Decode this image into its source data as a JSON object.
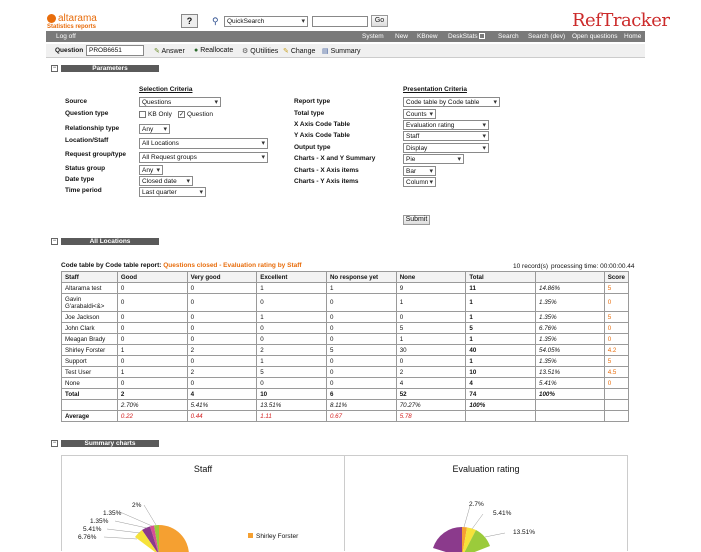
{
  "header": {
    "brand_name": "altarama",
    "brand_sub": "Statistics reports",
    "quicksearch_value": "QuickSearch",
    "go_label": "Go",
    "product_logo": "RefTracker"
  },
  "nav": {
    "logoff": "Log off",
    "items": [
      "System",
      "New",
      "KBnew",
      "DeskStats",
      "Search",
      "Search (dev)",
      "Open questions",
      "Home"
    ]
  },
  "question_bar": {
    "label": "Question",
    "value": "PROB6651",
    "actions": [
      "Answer",
      "Reallocate",
      "QUtilities",
      "Change",
      "Summary"
    ]
  },
  "parameters": {
    "title": "Parameters",
    "selection_header": "Selection Criteria",
    "presentation_header": "Presentation Criteria",
    "source_label": "Source",
    "source_value": "Questions",
    "question_type_label": "Question type",
    "kb_only_label": "KB Only",
    "question_label": "Question",
    "relationship_label": "Relationship type",
    "relationship_value": "Any",
    "location_label": "Location/Staff",
    "location_value": "All Locations",
    "request_group_label": "Request group/type",
    "request_group_value": "All Request groups",
    "status_label": "Status group",
    "status_value": "Any",
    "date_type_label": "Date type",
    "date_type_value": "Closed date",
    "time_period_label": "Time period",
    "time_period_value": "Last quarter",
    "report_type_label": "Report type",
    "report_type_value": "Code table by Code table",
    "total_type_label": "Total type",
    "total_type_value": "Counts",
    "x_axis_label": "X Axis Code Table",
    "x_axis_value": "Evaluation rating",
    "y_axis_label": "Y Axis Code Table",
    "y_axis_value": "Staff",
    "output_type_label": "Output type",
    "output_type_value": "Display",
    "charts_xy_label": "Charts - X and Y Summary",
    "charts_xy_value": "Pie",
    "charts_x_label": "Charts - X Axis items",
    "charts_x_value": "Bar",
    "charts_y_label": "Charts - Y Axis items",
    "charts_y_value": "Column",
    "submit_label": "Submit"
  },
  "results": {
    "section_title": "All Locations",
    "report_prefix": "Code table by Code table report:",
    "report_title": "Questions closed - Evaluation rating by Staff",
    "record_count": "10 record(s)",
    "processing_time": "processing time: 00:00:00.44",
    "columns": [
      "Staff",
      "Good",
      "Very good",
      "Excellent",
      "No response yet",
      "None",
      "Total",
      "",
      "Score"
    ],
    "rows": [
      {
        "name": "Altarama test",
        "good": "0",
        "very_good": "0",
        "excellent": "1",
        "no_response": "1",
        "none": "9",
        "total": "11",
        "pct": "14.86%",
        "score": "5"
      },
      {
        "name": "Gavin G'arabaldi<&>",
        "good": "0",
        "very_good": "0",
        "excellent": "0",
        "no_response": "0",
        "none": "1",
        "total": "1",
        "pct": "1.35%",
        "score": "0"
      },
      {
        "name": "Joe Jackson",
        "good": "0",
        "very_good": "0",
        "excellent": "1",
        "no_response": "0",
        "none": "0",
        "total": "1",
        "pct": "1.35%",
        "score": "5"
      },
      {
        "name": "John Clark",
        "good": "0",
        "very_good": "0",
        "excellent": "0",
        "no_response": "0",
        "none": "5",
        "total": "5",
        "pct": "6.76%",
        "score": "0"
      },
      {
        "name": "Meagan Brady",
        "good": "0",
        "very_good": "0",
        "excellent": "0",
        "no_response": "0",
        "none": "1",
        "total": "1",
        "pct": "1.35%",
        "score": "0"
      },
      {
        "name": "Shirley Forster",
        "good": "1",
        "very_good": "2",
        "excellent": "2",
        "no_response": "5",
        "none": "30",
        "total": "40",
        "pct": "54.05%",
        "score": "4.2"
      },
      {
        "name": "Support",
        "good": "0",
        "very_good": "0",
        "excellent": "1",
        "no_response": "0",
        "none": "0",
        "total": "1",
        "pct": "1.35%",
        "score": "5"
      },
      {
        "name": "Test User",
        "good": "1",
        "very_good": "2",
        "excellent": "5",
        "no_response": "0",
        "none": "2",
        "total": "10",
        "pct": "13.51%",
        "score": "4.5"
      },
      {
        "name": "None",
        "good": "0",
        "very_good": "0",
        "excellent": "0",
        "no_response": "0",
        "none": "4",
        "total": "4",
        "pct": "5.41%",
        "score": "0"
      }
    ],
    "total_row": {
      "label": "Total",
      "good": "2",
      "very_good": "4",
      "excellent": "10",
      "no_response": "6",
      "none": "52",
      "total": "74",
      "pct": "100%"
    },
    "pct_row": {
      "good": "2.70%",
      "very_good": "5.41%",
      "excellent": "13.51%",
      "no_response": "8.11%",
      "none": "70.27%",
      "total": "100%"
    },
    "average_row": {
      "label": "Average",
      "good": "0.22",
      "very_good": "0.44",
      "excellent": "1.11",
      "no_response": "0.67",
      "none": "5.78"
    }
  },
  "summary": {
    "title": "Summary charts",
    "staff_chart_title": "Staff",
    "staff_labels": [
      "2%",
      "1.35%",
      "1.35%",
      "5.41%",
      "6.76%"
    ],
    "staff_legend": "Shirley Forster",
    "eval_chart_title": "Evaluation rating",
    "eval_labels": [
      "2.7%",
      "5.41%",
      "13.51%"
    ]
  },
  "colors": {
    "nav_bg": "#7a7a7a",
    "bar_bg": "#5a5a5a",
    "brand_orange": "#e86d0c",
    "logo_red": "#cc2b2b",
    "pie_orange": "#f5a031",
    "pie_purple": "#8b3a8c",
    "pie_green": "#9bcb3b",
    "pie_pink": "#d95095",
    "pie_yellow": "#f6e23a"
  }
}
